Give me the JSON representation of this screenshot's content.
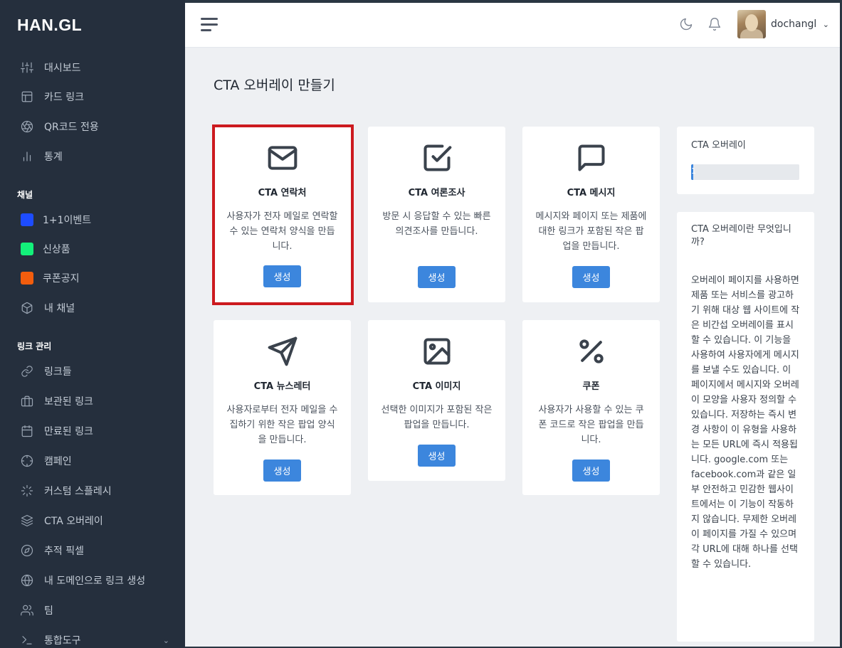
{
  "brand": {
    "logo": "HAN.GL"
  },
  "sidebar": {
    "items": [
      {
        "label": "대시보드",
        "icon": "sliders-icon"
      },
      {
        "label": "카드 링크",
        "icon": "layout-icon"
      },
      {
        "label": "QR코드 전용",
        "icon": "aperture-icon"
      },
      {
        "label": "통계",
        "icon": "bar-chart-icon"
      }
    ],
    "channels_heading": "채널",
    "channels": [
      {
        "label": "1+1이벤트",
        "color": "#1d4cff"
      },
      {
        "label": "신상품",
        "color": "#13f07a"
      },
      {
        "label": "쿠폰공지",
        "color": "#f25d0d"
      },
      {
        "label": "내 채널",
        "icon": "box-icon"
      }
    ],
    "links_heading": "링크 관리",
    "links": [
      {
        "label": "링크들",
        "icon": "link-icon"
      },
      {
        "label": "보관된 링크",
        "icon": "briefcase-icon"
      },
      {
        "label": "만료된 링크",
        "icon": "calendar-icon"
      },
      {
        "label": "캠페인",
        "icon": "crosshair-icon"
      },
      {
        "label": "커스텀 스플레시",
        "icon": "loader-icon"
      },
      {
        "label": "CTA 오버레이",
        "icon": "layers-icon"
      },
      {
        "label": "추적 픽셀",
        "icon": "compass-icon"
      },
      {
        "label": "내 도메인으로 링크 생성",
        "icon": "globe-icon"
      },
      {
        "label": "팀",
        "icon": "users-icon"
      },
      {
        "label": "통합도구",
        "icon": "terminal-icon"
      }
    ]
  },
  "topbar": {
    "username": "dochangl"
  },
  "main": {
    "title": "CTA 오버레이 만들기",
    "cards": [
      {
        "icon": "mail-icon",
        "title": "CTA 연락처",
        "desc": "사용자가 전자 메일로 연락할 수 있는 연락처 양식을 만듭니다.",
        "button": "생성"
      },
      {
        "icon": "check-square-icon",
        "title": "CTA 여론조사",
        "desc": "방문 시 응답할 수 있는 빠른 의견조사를 만듭니다.",
        "button": "생성"
      },
      {
        "icon": "message-square-icon",
        "title": "CTA 메시지",
        "desc": "메시지와 페이지 또는 제품에 대한 링크가 포함된 작은 팝업을 만듭니다.",
        "button": "생성"
      },
      {
        "icon": "send-icon",
        "title": "CTA 뉴스레터",
        "desc": "사용자로부터 전자 메일을 수집하기 위한 작은 팝업 양식을 만듭니다.",
        "button": "생성"
      },
      {
        "icon": "image-icon",
        "title": "CTA 이미지",
        "desc": "선택한 이미지가 포함된 작은 팝업을 만듭니다.",
        "button": "생성"
      },
      {
        "icon": "percent-icon",
        "title": "쿠폰",
        "desc": "사용자가 사용할 수 있는 쿠폰 코드로 작은 팝업을 만듭니다.",
        "button": "생성"
      }
    ]
  },
  "usage": {
    "title": "CTA 오버레이",
    "value": "1",
    "progress": 0.02
  },
  "info": {
    "title": "CTA 오버레이란 무엇입니까?",
    "body": "오버레이 페이지를 사용하면 제품 또는 서비스를 광고하기 위해 대상 웹 사이트에 작은 비간섭 오버레이를 표시할 수 있습니다. 이 기능을 사용하여 사용자에게 메시지를 보낼 수도 있습니다. 이 페이지에서 메시지와 오버레이 모양을 사용자 정의할 수 있습니다. 저장하는 즉시 변경 사항이 이 유형을 사용하는 모든 URL에 즉시 적용됩니다. google.com 또는 facebook.com과 같은 일부 안전하고 민감한 웹사이트에서는 이 기능이 작동하지 않습니다. 무제한 오버레이 페이지를 가질 수 있으며 각 URL에 대해 하나를 선택할 수 있습니다."
  }
}
